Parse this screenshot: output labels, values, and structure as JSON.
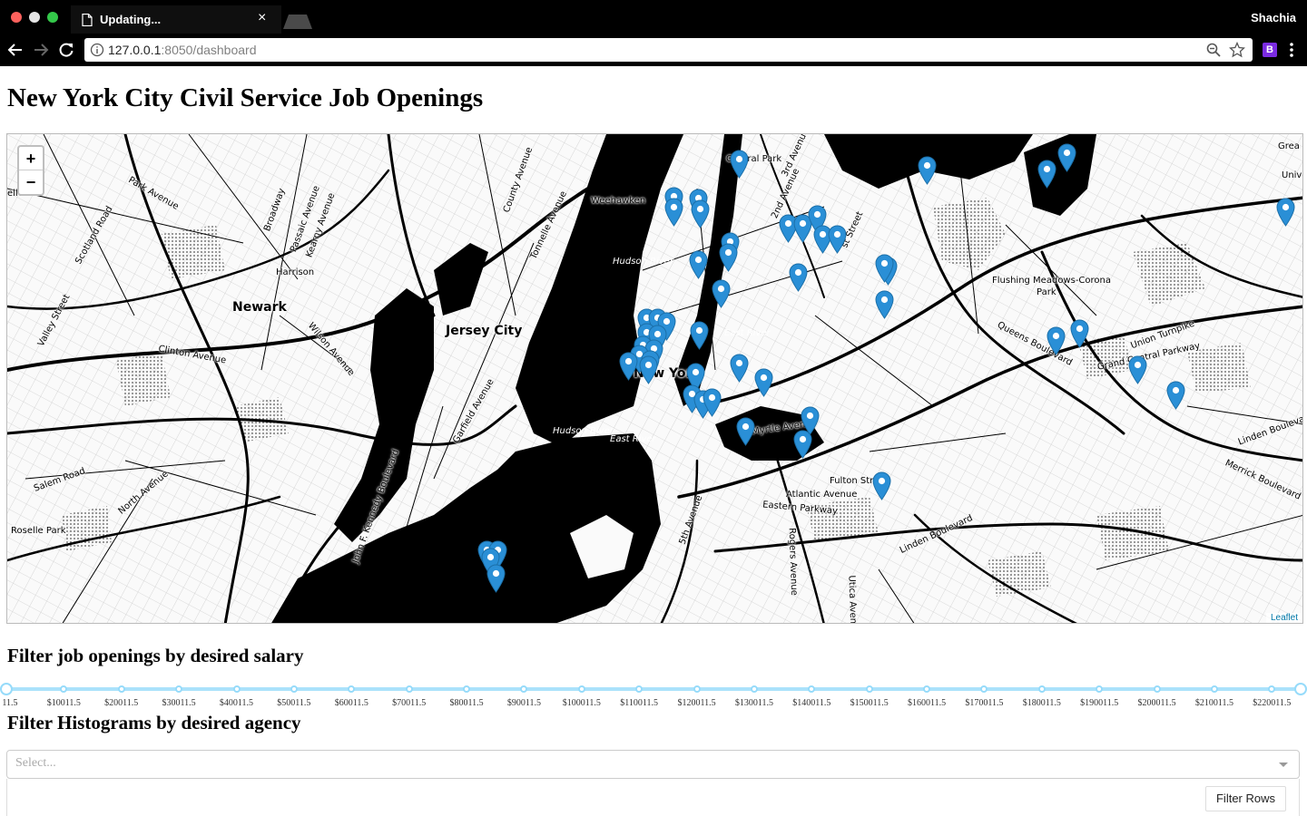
{
  "browser": {
    "tab_title": "Updating...",
    "tab_close": "×",
    "profile_name": "Shachia",
    "url_host": "127.0.0.1",
    "url_path": ":8050/dashboard",
    "extension_badge": "B"
  },
  "page": {
    "title": "New York City Civil Service Job Openings"
  },
  "map": {
    "zoom_in": "+",
    "zoom_out": "−",
    "attribution": "Leaflet",
    "marker_color": "#2a8fd6",
    "labels": {
      "newark": "Newark",
      "jersey_city": "Jersey City",
      "harrison": "Harrison",
      "weehawken": "Weehawken",
      "new_york": "New York",
      "hudson_river_1": "Hudson River",
      "hudson_river_2": "Hudson River",
      "east_river_1": "East River",
      "east_river_2": "East River",
      "central_park": "Central Park",
      "flushing": "Flushing Meadows-Corona",
      "flushing_park": "Park",
      "park_ave": "Park Avenue",
      "scotland_road": "Scotland Road",
      "valley_street": "Valley Street",
      "clinton_ave": "Clinton Avenue",
      "wilson_ave": "Wilson Avenue",
      "salem_road": "Salem Road",
      "north_ave": "North Avenue",
      "roselle_park": "Roselle Park",
      "garfield_ave": "Garfield Avenue",
      "jfk_blvd": "John F. Kennedy Boulevard",
      "county_ave": "County Avenue",
      "tonnelle_ave": "Tonnelle Avenue",
      "broadway": "Broadway",
      "passaic_ave": "Passaic Avenue",
      "kearny_ave": "Kearny Avenue",
      "myrtle_ave": "Myrtle Avenue",
      "fulton_st": "Fulton Street",
      "atlantic_ave": "Atlantic Avenue",
      "eastern_pkwy": "Eastern Parkway",
      "linden_blvd_1": "Linden Boulevard",
      "linden_blvd_2": "Linden Boulevard",
      "merrick_blvd": "Merrick Boulevard",
      "union_tpke": "Union Turnpike",
      "grand_central": "Grand Central Parkway",
      "queens_blvd": "Queens Boulevard",
      "rogers_ave": "Rogers Avenue",
      "utica_ave": "Utica Avenue",
      "fifth_ave": "5th Avenue",
      "second_ave": "2nd Avenue",
      "third_ave": "3rd Avenue",
      "great": "Grea",
      "univ": "Univ",
      "kelle": "elle",
      "st": "st Street"
    }
  },
  "filters": {
    "salary_title": "Filter job openings by desired salary",
    "agency_title": "Filter Histograms by desired agency",
    "salary_marks": [
      "11.5",
      "$10011.5",
      "$20011.5",
      "$30011.5",
      "$40011.5",
      "$50011.5",
      "$60011.5",
      "$70011.5",
      "$80011.5",
      "$90011.5",
      "$100011.5",
      "$110011.5",
      "$120011.5",
      "$130011.5",
      "$140011.5",
      "$150011.5",
      "$160011.5",
      "$170011.5",
      "$180011.5",
      "$190011.5",
      "$200011.5",
      "$210011.5",
      "$220011.5"
    ],
    "slider_range": {
      "min": 11.5,
      "max": 225011.5,
      "selected_low": 11.5,
      "selected_high": 225011.5
    },
    "agency_placeholder": "Select...",
    "filter_rows_label": "Filter Rows"
  }
}
